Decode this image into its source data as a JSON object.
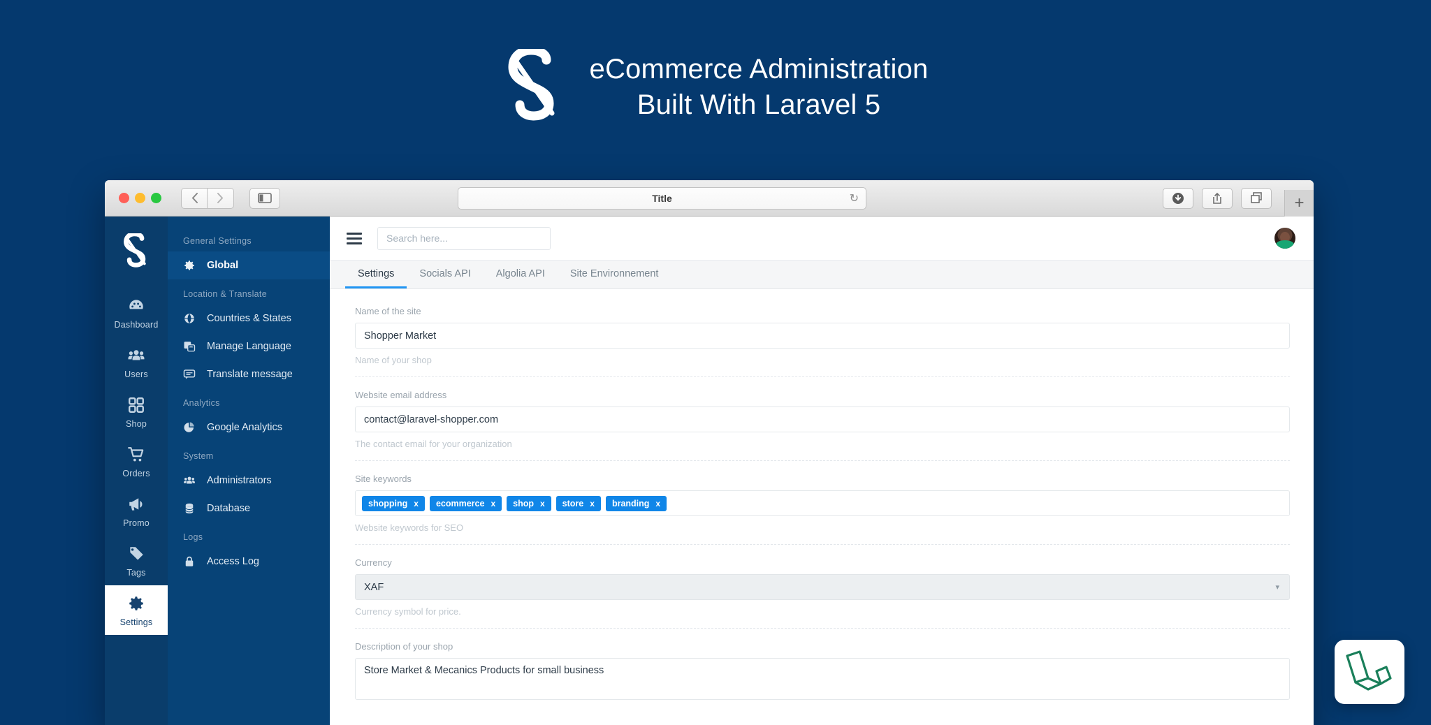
{
  "promo": {
    "logo_icon": "shopper-s-logo",
    "line1": "eCommerce Administration",
    "line2": "Built With Laravel 5"
  },
  "browser": {
    "address_title": "Title",
    "reload_icon": "reload-icon",
    "back_icon": "chevron-left-icon",
    "forward_icon": "chevron-right-icon",
    "sidebar_icon": "sidebar-toggle-icon",
    "download_icon": "download-icon",
    "share_icon": "share-icon",
    "tabs_icon": "show-tabs-icon",
    "new_tab_label": "+"
  },
  "rail": {
    "logo_icon": "shopper-s-logo",
    "items": [
      {
        "label": "Dashboard",
        "icon": "dashboard-gauge-icon",
        "active": false
      },
      {
        "label": "Users",
        "icon": "users-icon",
        "active": false
      },
      {
        "label": "Shop",
        "icon": "grid-icon",
        "active": false
      },
      {
        "label": "Orders",
        "icon": "shopping-cart-icon",
        "active": false
      },
      {
        "label": "Promo",
        "icon": "megaphone-icon",
        "active": false
      },
      {
        "label": "Tags",
        "icon": "tag-icon",
        "active": false
      },
      {
        "label": "Settings",
        "icon": "gear-icon",
        "active": true
      }
    ]
  },
  "subnav": {
    "sections": [
      {
        "title": "General Settings",
        "items": [
          {
            "label": "Global",
            "icon": "gear-icon",
            "active": true
          }
        ]
      },
      {
        "title": "Location & Translate",
        "items": [
          {
            "label": "Countries & States",
            "icon": "globe-icon",
            "active": false
          },
          {
            "label": "Manage Language",
            "icon": "language-icon",
            "active": false
          },
          {
            "label": "Translate message",
            "icon": "message-icon",
            "active": false
          }
        ]
      },
      {
        "title": "Analytics",
        "items": [
          {
            "label": "Google Analytics",
            "icon": "pie-chart-icon",
            "active": false
          }
        ]
      },
      {
        "title": "System",
        "items": [
          {
            "label": "Administrators",
            "icon": "users-icon",
            "active": false
          },
          {
            "label": "Database",
            "icon": "database-icon",
            "active": false
          }
        ]
      },
      {
        "title": "Logs",
        "items": [
          {
            "label": "Access Log",
            "icon": "lock-icon",
            "active": false
          }
        ]
      }
    ]
  },
  "topbar": {
    "menu_icon": "hamburger-menu-icon",
    "search_placeholder": "Search here...",
    "search_value": "",
    "avatar_icon": "user-avatar"
  },
  "tabs": [
    {
      "label": "Settings",
      "active": true
    },
    {
      "label": "Socials API",
      "active": false
    },
    {
      "label": "Algolia API",
      "active": false
    },
    {
      "label": "Site Environnement",
      "active": false
    }
  ],
  "form": {
    "site_name": {
      "label": "Name of the site",
      "value": "Shopper Market",
      "help": "Name of your shop"
    },
    "email": {
      "label": "Website email address",
      "value": "contact@laravel-shopper.com",
      "help": "The contact email for your organization"
    },
    "keywords": {
      "label": "Site keywords",
      "help": "Website keywords for SEO",
      "remove_label": "x",
      "tags": [
        "shopping",
        "ecommerce",
        "shop",
        "store",
        "branding"
      ]
    },
    "currency": {
      "label": "Currency",
      "value": "XAF",
      "help": "Currency symbol for price.",
      "caret_icon": "chevron-down-icon"
    },
    "description": {
      "label": "Description of your shop",
      "value": "Store Market & Mecanics Products for small business"
    }
  },
  "badge": {
    "icon": "laravel-logo"
  },
  "colors": {
    "background": "#05396e",
    "rail": "#0a3d6b",
    "subnav": "#074377",
    "accent": "#2196f3",
    "tag": "#1086e8",
    "laravel_green": "#1a7f5a"
  }
}
